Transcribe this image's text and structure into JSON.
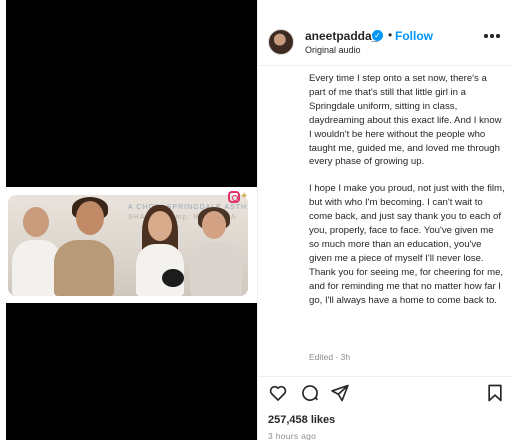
{
  "media": {
    "banner_line1": "A CHORI SPRINGDALE ASTH",
    "banner_line2": "SHANAY &amp; RE PADDA"
  },
  "header": {
    "username": "aneetpadda_",
    "separator": "•",
    "follow_label": "Follow",
    "audio_label": "Original audio"
  },
  "caption": {
    "paragraph1": "Every time I step onto a set now, there's a part of me that's still that little girl in a Springdale uniform, sitting in class, daydreaming about this exact life. And I know I wouldn't be here without the people who taught me, guided me, and loved me through every phase of growing up.",
    "paragraph2": "I hope I make you proud, not just with the film, but with who I'm becoming. I can't wait to come back, and just say thank you to each of you, properly, face to face. You've given me so much more than an education, you've given me a piece of myself I'll never lose. Thank you for seeing me, for cheering for me, and for reminding me that no matter how far I go, I'll always have a home to come back to.",
    "edited": "Edited · 3h"
  },
  "footer": {
    "likes": "257,458 likes",
    "time": "3 hours ago"
  },
  "icons": {
    "verified": "verified-badge",
    "more": "more-icon",
    "like": "heart-icon",
    "comment": "comment-icon",
    "share": "share-icon",
    "save": "bookmark-icon"
  },
  "colors": {
    "accent": "#0095f6",
    "text": "#262626",
    "muted": "#8e8e8e"
  }
}
